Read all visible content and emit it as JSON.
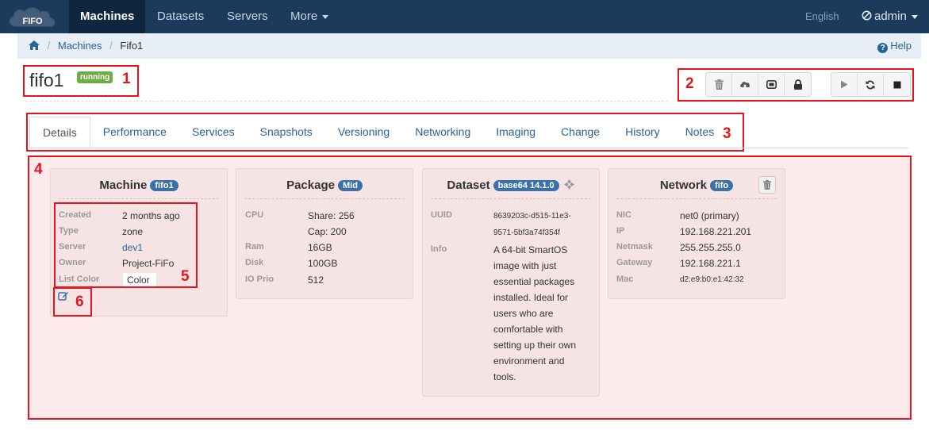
{
  "brand": {
    "logo_text": "FIFO"
  },
  "nav": {
    "items": [
      {
        "label": "Machines"
      },
      {
        "label": "Datasets"
      },
      {
        "label": "Servers"
      },
      {
        "label": "More"
      }
    ],
    "language": "English",
    "user": "admin"
  },
  "breadcrumb": {
    "machines": "Machines",
    "current": "Fifo1",
    "help": "Help"
  },
  "machine": {
    "name": "fifo1",
    "state": "running"
  },
  "annotations": [
    "1",
    "2",
    "3",
    "4",
    "5",
    "6"
  ],
  "tabs": [
    "Details",
    "Performance",
    "Services",
    "Snapshots",
    "Versioning",
    "Networking",
    "Imaging",
    "Change",
    "History",
    "Notes"
  ],
  "cards": {
    "machine": {
      "title": "Machine",
      "badge": "fifo1",
      "rows": [
        {
          "label": "Created",
          "value": "2 months ago"
        },
        {
          "label": "Type",
          "value": "zone"
        },
        {
          "label": "Server",
          "value": "dev1"
        },
        {
          "label": "Owner",
          "value": "Project-FiFo"
        },
        {
          "label": "List Color",
          "value": "Color"
        }
      ]
    },
    "package": {
      "title": "Package",
      "badge": "Mid",
      "rows": [
        {
          "label": "CPU",
          "value": "Share: 256"
        },
        {
          "label": "",
          "value": "Cap: 200"
        },
        {
          "label": "Ram",
          "value": "16GB"
        },
        {
          "label": "Disk",
          "value": "100GB"
        },
        {
          "label": "IO Prio",
          "value": "512"
        }
      ]
    },
    "dataset": {
      "title": "Dataset",
      "badge": "base64 14.1.0",
      "uuid_label": "UUID",
      "uuid_lines": [
        "8639203c-d515-11e3-",
        "9571-5bf3a74f354f"
      ],
      "info_label": "Info",
      "info_lines": [
        "A 64-bit SmartOS",
        "image with just",
        "essential packages",
        "installed. Ideal for",
        "users who are",
        "comfortable with",
        "setting up their own",
        "environment and",
        "tools."
      ]
    },
    "network": {
      "title": "Network",
      "badge": "fifo",
      "rows": [
        {
          "label": "NIC",
          "value": "net0 (primary)"
        },
        {
          "label": "IP",
          "value": "192.168.221.201"
        },
        {
          "label": "Netmask",
          "value": "255.255.255.0"
        },
        {
          "label": "Gateway",
          "value": "192.168.221.1"
        },
        {
          "label": "Mac",
          "value": "d2:e9:b0:e1:42:32"
        }
      ]
    }
  },
  "colors": {
    "accent": "#1b3a5c",
    "annotation": "#e8141c",
    "running": "#6cae45",
    "badge": "#3a72a8",
    "link": "#2a6496"
  }
}
